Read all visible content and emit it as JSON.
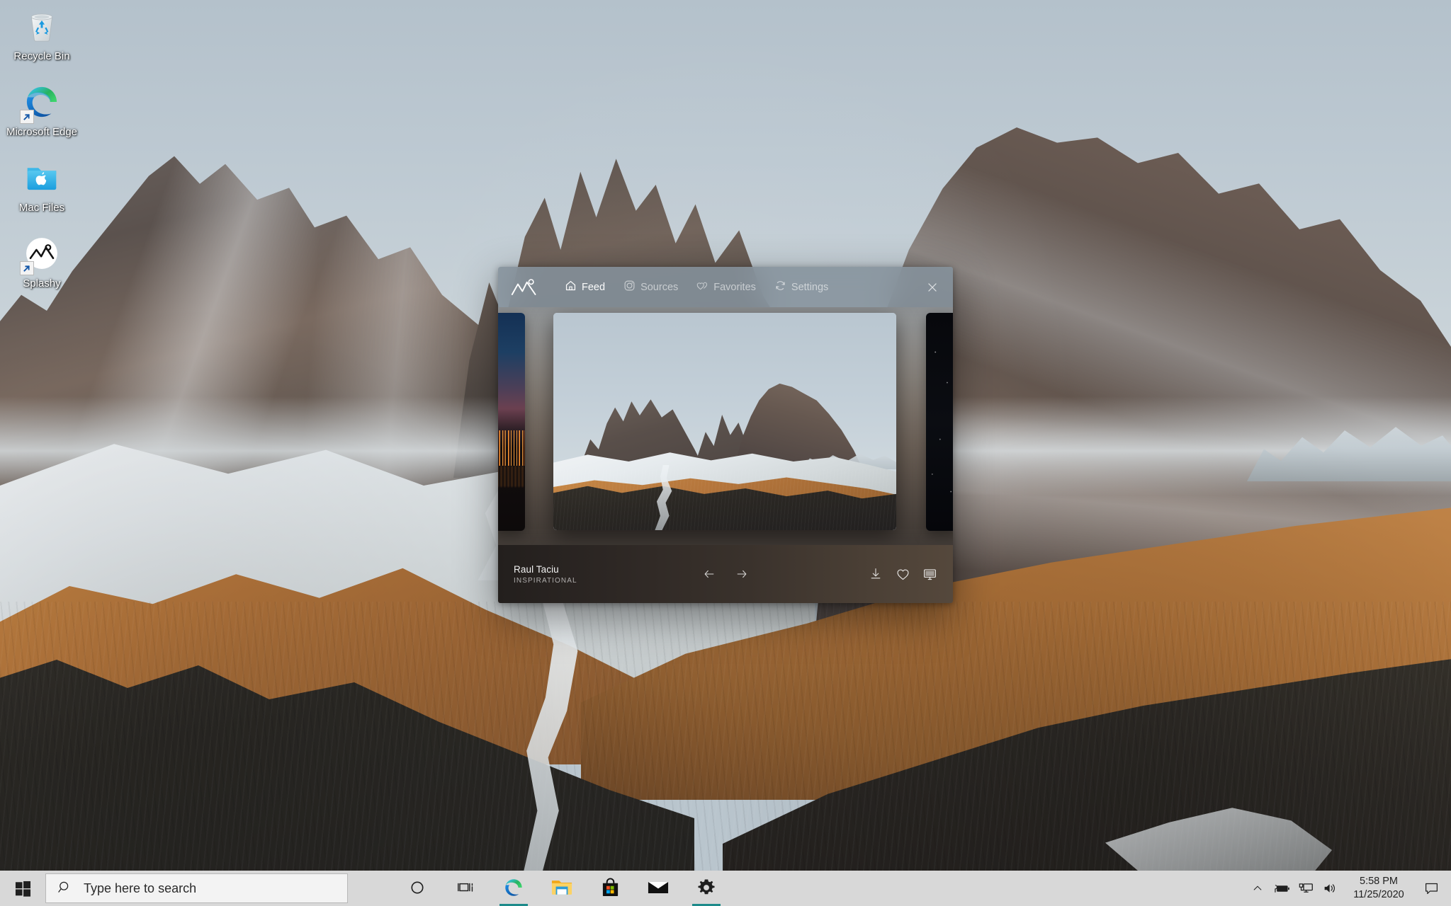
{
  "desktop": {
    "icons": [
      {
        "label": "Recycle Bin",
        "icon": "recycle-bin-icon",
        "shortcut": false
      },
      {
        "label": "Microsoft Edge",
        "icon": "microsoft-edge-icon",
        "shortcut": true
      },
      {
        "label": "Mac Files",
        "icon": "mac-files-folder-icon",
        "shortcut": false
      },
      {
        "label": "Splashy",
        "icon": "splashy-app-icon",
        "shortcut": true
      }
    ],
    "wallpaper_alt": "Snow-covered Dolomites mountain range at sunrise with golden alpine slopes and dark pine forest"
  },
  "splashy_window": {
    "app_name": "Splashy",
    "logo_icon": "mountain-sun-logo-icon",
    "close_label": "✕",
    "close_icon": "close-icon",
    "tabs": [
      {
        "label": "Feed",
        "icon": "home-icon",
        "active": true
      },
      {
        "label": "Sources",
        "icon": "camera-icon",
        "active": false
      },
      {
        "label": "Favorites",
        "icon": "double-heart-icon",
        "active": false
      },
      {
        "label": "Settings",
        "icon": "sync-refresh-icon",
        "active": false
      }
    ],
    "carousel": {
      "previous_thumb_alt": "City skyline at dusk with orange lights reflected on water",
      "current_photo_alt": "Dolomites mountain peaks with snow, golden slopes and pine forest valley",
      "next_thumb_alt": "Dark night sky with stars"
    },
    "footer": {
      "author": "Raul Taciu",
      "category": "INSPIRATIONAL",
      "prev_label": "←",
      "next_label": "→",
      "prev_icon": "arrow-left-icon",
      "next_icon": "arrow-right-icon",
      "actions": [
        {
          "name": "download-icon",
          "title": "Download"
        },
        {
          "name": "heart-icon",
          "title": "Favorite"
        },
        {
          "name": "monitor-icon",
          "title": "Set as wallpaper"
        }
      ]
    }
  },
  "taskbar": {
    "start_icon": "windows-start-icon",
    "search": {
      "placeholder": "Type here to search",
      "value": "",
      "icon": "search-icon"
    },
    "apps": [
      {
        "name": "cortana-icon",
        "label": "Cortana",
        "active": false
      },
      {
        "name": "task-view-icon",
        "label": "Task View",
        "active": false
      },
      {
        "name": "microsoft-edge-icon",
        "label": "Microsoft Edge",
        "active": true
      },
      {
        "name": "file-explorer-icon",
        "label": "File Explorer",
        "active": false
      },
      {
        "name": "microsoft-store-icon",
        "label": "Microsoft Store",
        "active": false
      },
      {
        "name": "mail-icon",
        "label": "Mail",
        "active": false
      },
      {
        "name": "settings-gear-icon",
        "label": "Settings",
        "active": true
      }
    ],
    "tray": [
      {
        "name": "chevron-up-icon",
        "label": "Show hidden icons"
      },
      {
        "name": "battery-charging-icon",
        "label": "Battery"
      },
      {
        "name": "network-icon",
        "label": "Network"
      },
      {
        "name": "volume-icon",
        "label": "Volume"
      }
    ],
    "clock": {
      "time": "5:58 PM",
      "date": "11/25/2020"
    },
    "notifications_icon": "notification-chat-icon"
  },
  "colors": {
    "taskbar_bg": "#d8d8d8",
    "taskbar_accent": "#1d8a8a",
    "window_titlebar": "#84919b",
    "window_footer": "#2d2724",
    "edge_blue": "#0f6cbd",
    "folder_blue": "#3fb4e8"
  }
}
